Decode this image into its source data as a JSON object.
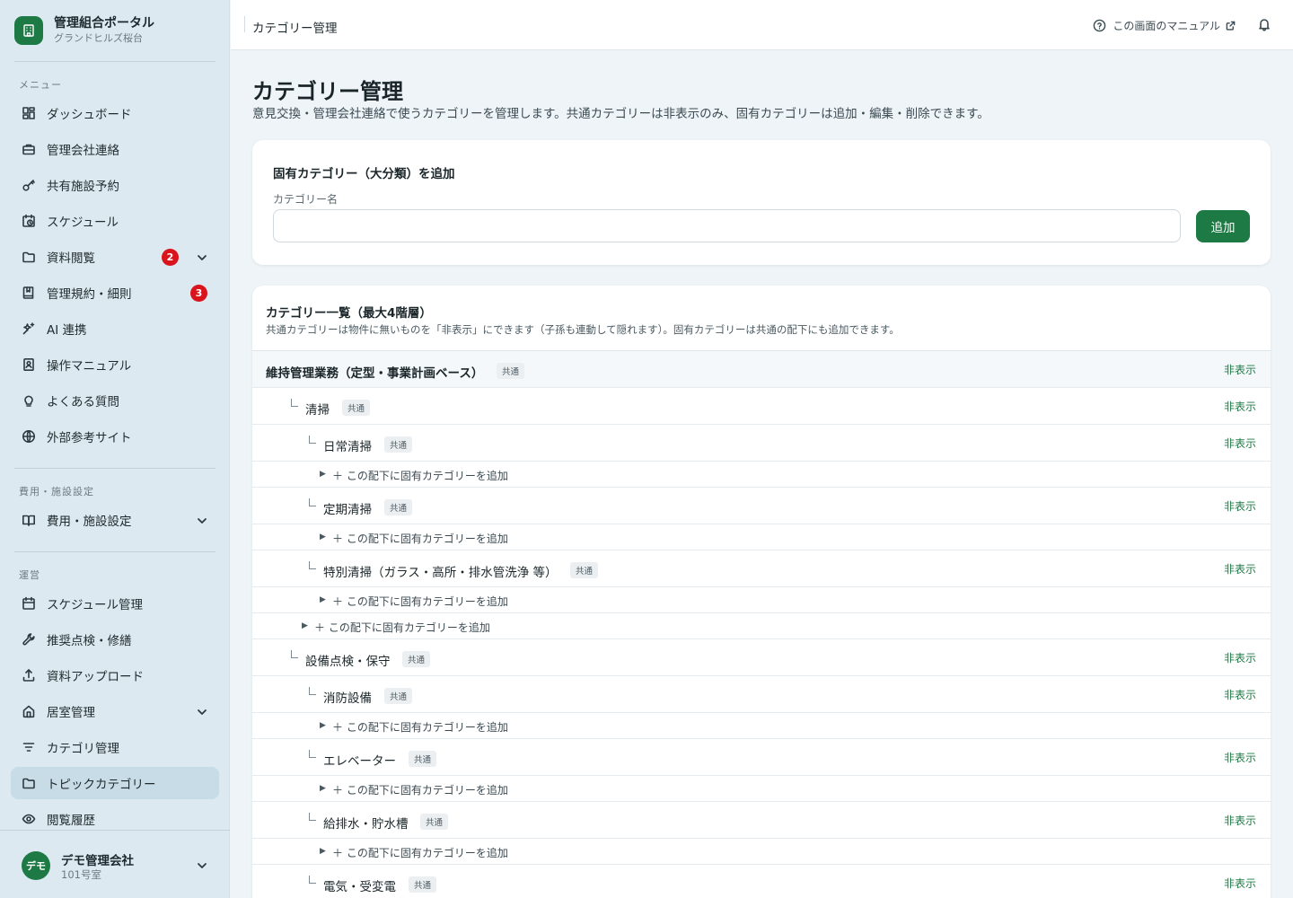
{
  "brand": {
    "title": "管理組合ポータル",
    "subtitle": "グランドヒルズ桜台"
  },
  "sidebar": {
    "sections": [
      {
        "label": "メニュー"
      },
      {
        "label": "費用・施設設定"
      },
      {
        "label": "運営"
      }
    ],
    "items": [
      {
        "label": "ダッシュボード",
        "icon": "dashboard-icon"
      },
      {
        "label": "管理会社連絡",
        "icon": "briefcase-icon"
      },
      {
        "label": "共有施設予約",
        "icon": "key-icon"
      },
      {
        "label": "スケジュール",
        "icon": "calendar-clock-icon"
      },
      {
        "label": "資料閲覧",
        "icon": "folder-icon",
        "badge": "2",
        "expandable": true
      },
      {
        "label": "管理規約・細則",
        "icon": "book-bookmark-icon",
        "badge": "3"
      },
      {
        "label": "AI 連携",
        "icon": "sparkles-icon"
      },
      {
        "label": "操作マニュアル",
        "icon": "manual-icon"
      },
      {
        "label": "よくある質問",
        "icon": "lightbulb-icon"
      },
      {
        "label": "外部参考サイト",
        "icon": "globe-icon"
      },
      {
        "label": "費用・施設設定",
        "icon": "open-book-icon",
        "expandable": true
      },
      {
        "label": "スケジュール管理",
        "icon": "calendar-icon"
      },
      {
        "label": "推奨点検・修繕",
        "icon": "wrench-icon"
      },
      {
        "label": "資料アップロード",
        "icon": "upload-icon"
      },
      {
        "label": "居室管理",
        "icon": "home-icon",
        "expandable": true
      },
      {
        "label": "カテゴリ管理",
        "icon": "filter-icon"
      },
      {
        "label": "トピックカテゴリー",
        "icon": "folder-icon",
        "active": true
      },
      {
        "label": "閲覧履歴",
        "icon": "eye-icon"
      }
    ]
  },
  "user": {
    "avatar": "デモ",
    "name": "デモ管理会社",
    "room": "101号室"
  },
  "topbar": {
    "title": "カテゴリー管理",
    "manual_link": "この画面のマニュアル"
  },
  "page": {
    "title": "カテゴリー管理",
    "description": "意見交換・管理会社連絡で使うカテゴリーを管理します。共通カテゴリーは非表示のみ、固有カテゴリーは追加・編集・削除できます。"
  },
  "add_card": {
    "title": "固有カテゴリー（大分類）を追加",
    "field_label": "カテゴリー名",
    "input_value": "",
    "input_placeholder": "",
    "button": "追加"
  },
  "list_card": {
    "title": "カテゴリー一覧（最大4階層）",
    "description": "共通カテゴリーは物件に無いものを「非表示」にできます（子孫も連動して隠れます）。固有カテゴリーは共通の配下にも追加できます。",
    "hide_label": "非表示",
    "add_child_label": "＋ この配下に固有カテゴリーを追加",
    "add_arrow": "▶",
    "rows": [
      {
        "type": "category",
        "level": 1,
        "name": "維持管理業務（定型・事業計画ベース）",
        "tag": "共通"
      },
      {
        "type": "category",
        "level": 2,
        "name": "清掃",
        "tag": "共通"
      },
      {
        "type": "category",
        "level": 3,
        "name": "日常清掃",
        "tag": "共通"
      },
      {
        "type": "add",
        "level": 3
      },
      {
        "type": "category",
        "level": 3,
        "name": "定期清掃",
        "tag": "共通"
      },
      {
        "type": "add",
        "level": 3
      },
      {
        "type": "category",
        "level": 3,
        "name": "特別清掃（ガラス・高所・排水管洗浄 等）",
        "tag": "共通"
      },
      {
        "type": "add",
        "level": 3
      },
      {
        "type": "add",
        "level": 2
      },
      {
        "type": "category",
        "level": 2,
        "name": "設備点検・保守",
        "tag": "共通"
      },
      {
        "type": "category",
        "level": 3,
        "name": "消防設備",
        "tag": "共通"
      },
      {
        "type": "add",
        "level": 3
      },
      {
        "type": "category",
        "level": 3,
        "name": "エレベーター",
        "tag": "共通"
      },
      {
        "type": "add",
        "level": 3
      },
      {
        "type": "category",
        "level": 3,
        "name": "給排水・貯水槽",
        "tag": "共通"
      },
      {
        "type": "add",
        "level": 3
      },
      {
        "type": "category",
        "level": 3,
        "name": "電気・受変電",
        "tag": "共通"
      }
    ]
  },
  "colors": {
    "accent": "#1e7a45",
    "badge": "#d9141c",
    "sidebar_bg": "#dde9f0",
    "page_bg": "#eef4f7"
  }
}
